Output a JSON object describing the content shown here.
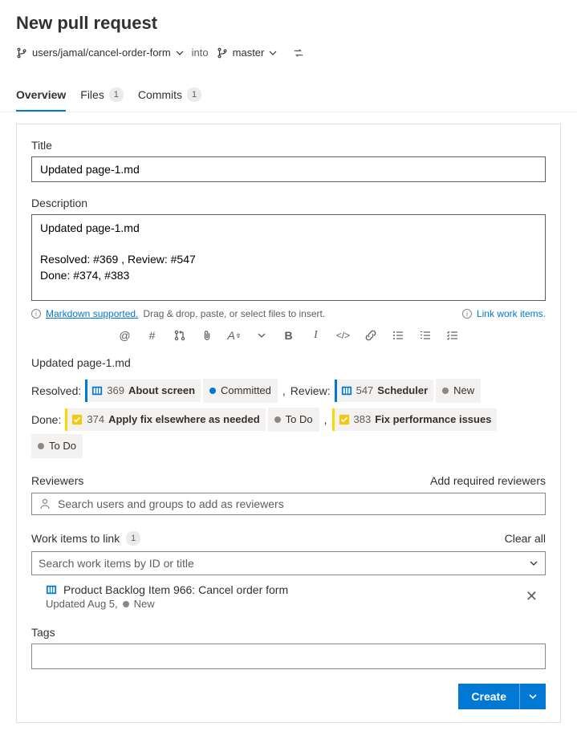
{
  "header": {
    "title": "New pull request",
    "source_branch": "users/jamal/cancel-order-form",
    "into": "into",
    "target_branch": "master"
  },
  "tabs": {
    "overview": "Overview",
    "files": "Files",
    "files_count": "1",
    "commits": "Commits",
    "commits_count": "1"
  },
  "form": {
    "title_label": "Title",
    "title_value": "Updated page-1.md",
    "description_label": "Description",
    "description_value": "Updated page-1.md\n\nResolved: #369 , Review: #547\nDone: #374, #383",
    "markdown_supported": "Markdown supported.",
    "drag_hint": "Drag & drop, paste, or select files to insert.",
    "link_work_items": "Link work items."
  },
  "preview": {
    "title": "Updated page-1.md",
    "rows": [
      {
        "label": "Resolved:",
        "items": [
          {
            "type": "wi",
            "color": "blue",
            "id": "369",
            "title": "About screen"
          },
          {
            "type": "status",
            "dot": "blue",
            "text": "Committed"
          },
          {
            "type": "comma",
            "text": ","
          },
          {
            "type": "label",
            "text": "Review:"
          },
          {
            "type": "wi",
            "color": "blue",
            "id": "547",
            "title": "Scheduler"
          },
          {
            "type": "status",
            "dot": "grey",
            "text": "New"
          }
        ]
      },
      {
        "label": "Done:",
        "items": [
          {
            "type": "wi",
            "color": "yellow",
            "id": "374",
            "title": "Apply fix elsewhere as needed"
          },
          {
            "type": "status",
            "dot": "grey",
            "text": "To Do"
          },
          {
            "type": "comma",
            "text": ","
          },
          {
            "type": "wi",
            "color": "yellow",
            "id": "383",
            "title": "Fix performance issues"
          },
          {
            "type": "status",
            "dot": "grey",
            "text": "To Do"
          }
        ]
      }
    ]
  },
  "reviewers": {
    "label": "Reviewers",
    "add_required": "Add required reviewers",
    "placeholder": "Search users and groups to add as reviewers"
  },
  "work_items": {
    "label": "Work items to link",
    "count": "1",
    "clear_all": "Clear all",
    "placeholder": "Search work items by ID or title",
    "linked": {
      "title": "Product Backlog Item 966: Cancel order form",
      "updated": "Updated Aug 5,",
      "status": "New"
    }
  },
  "tags": {
    "label": "Tags"
  },
  "footer": {
    "create": "Create"
  }
}
